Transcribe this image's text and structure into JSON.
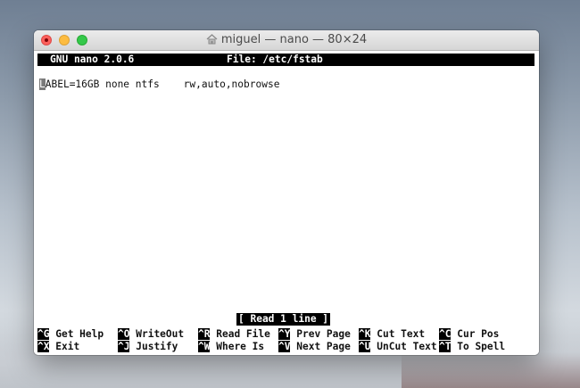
{
  "window": {
    "title": "miguel — nano — 80×24"
  },
  "nano": {
    "version_label": "GNU nano 2.0.6",
    "file_label": "File: /etc/fstab",
    "content": {
      "cursor_char": "L",
      "line_rest": "ABEL=16GB none ntfs    rw,auto,nobrowse"
    },
    "status_message": "[ Read 1 line ]",
    "shortcuts_row1": [
      {
        "key": "^G",
        "label": "Get Help"
      },
      {
        "key": "^O",
        "label": "WriteOut"
      },
      {
        "key": "^R",
        "label": "Read File"
      },
      {
        "key": "^Y",
        "label": "Prev Page"
      },
      {
        "key": "^K",
        "label": "Cut Text"
      },
      {
        "key": "^C",
        "label": "Cur Pos"
      }
    ],
    "shortcuts_row2": [
      {
        "key": "^X",
        "label": "Exit"
      },
      {
        "key": "^J",
        "label": "Justify"
      },
      {
        "key": "^W",
        "label": "Where Is"
      },
      {
        "key": "^V",
        "label": "Next Page"
      },
      {
        "key": "^U",
        "label": "UnCut Text"
      },
      {
        "key": "^T",
        "label": "To Spell"
      }
    ]
  },
  "colors": {
    "close": "#fc605c",
    "minimize": "#fdbc40",
    "maximize": "#34c84a",
    "terminal_bg": "#ffffff",
    "bar_bg": "#000000"
  }
}
